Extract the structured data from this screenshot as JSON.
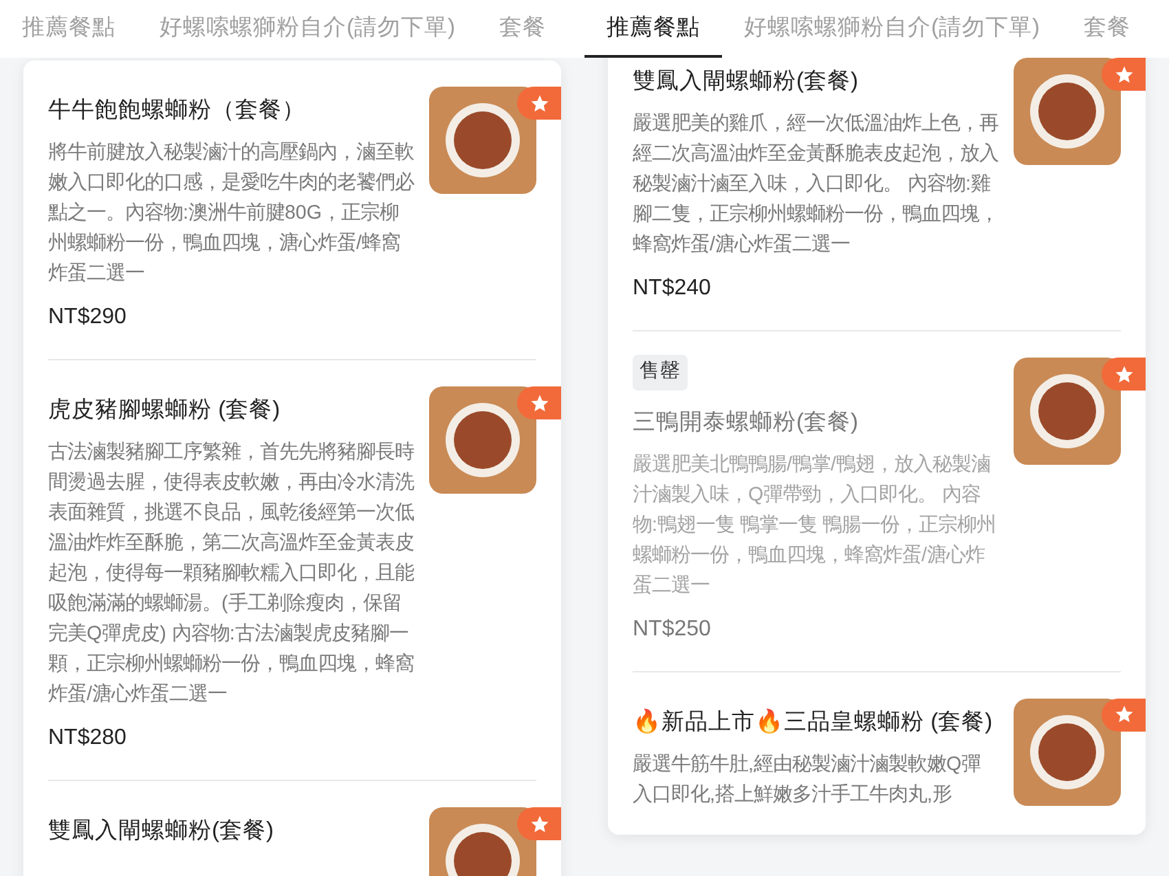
{
  "panels": [
    {
      "tabs": [
        {
          "label": "推薦餐點",
          "selected": false
        },
        {
          "label": "好螺嗦螺獅粉自介(請勿下單)",
          "selected": false
        },
        {
          "label": "套餐",
          "selected": false
        }
      ],
      "scrolled": false,
      "items": [
        {
          "title": "牛牛飽飽螺螄粉（套餐）",
          "description": "將牛前腱放入秘製滷汁的高壓鍋內，滷至軟嫩入口即化的口感，是愛吃牛肉的老饕們必點之一。內容物:澳洲牛前腱80G，正宗柳州螺螄粉一份，鴨血四塊，溏心炸蛋/蜂窩炸蛋二選一",
          "price": "NT$290",
          "starred": true,
          "sold_out": false
        },
        {
          "title": "虎皮豬腳螺螄粉 (套餐)",
          "description": "古法滷製豬腳工序繁雜，首先先將豬腳長時間燙過去腥，使得表皮軟嫩，再由冷水清洗表面雜質，挑選不良品，風乾後經第一次低溫油炸炸至酥脆，第二次高溫炸至金黃表皮起泡，使得每一顆豬腳軟糯入口即化，且能吸飽滿滿的螺螄湯。(手工剃除瘦肉，保留完美Q彈虎皮) 內容物:古法滷製虎皮豬腳一顆，正宗柳州螺螄粉一份，鴨血四塊，蜂窩炸蛋/溏心炸蛋二選一",
          "price": "NT$280",
          "starred": true,
          "sold_out": false
        },
        {
          "title": "雙鳳入閘螺螄粉(套餐)",
          "starred": true,
          "sold_out": false
        }
      ]
    },
    {
      "tabs": [
        {
          "label": "推薦餐點",
          "selected": true
        },
        {
          "label": "好螺嗦螺獅粉自介(請勿下單)",
          "selected": false
        },
        {
          "label": "套餐",
          "selected": false
        }
      ],
      "scrolled": true,
      "items": [
        {
          "title": "雙鳳入閘螺螄粉(套餐)",
          "description": "嚴選肥美的雞爪，經一次低溫油炸上色，再經二次高溫油炸至金黃酥脆表皮起泡，放入秘製滷汁滷至入味，入口即化。 內容物:雞腳二隻，正宗柳州螺螄粉一份，鴨血四塊，蜂窩炸蛋/溏心炸蛋二選一",
          "price": "NT$240",
          "starred": true,
          "sold_out": false
        },
        {
          "badge": "售罄",
          "title": "三鴨開泰螺螄粉(套餐)",
          "description": "嚴選肥美北鴨鴨腸/鴨掌/鴨翅，放入秘製滷汁滷製入味，Q彈帶勁，入口即化。 內容物:鴨翅一隻 鴨掌一隻 鴨腸一份，正宗柳州螺螄粉一份，鴨血四塊，蜂窩炸蛋/溏心炸蛋二選一",
          "price": "NT$250",
          "starred": true,
          "sold_out": true
        },
        {
          "title": "🔥新品上市🔥三品皇螺螄粉 (套餐)",
          "description": "嚴選牛筋牛肚,經由秘製滷汁滷製軟嫩Q彈入口即化,搭上鮮嫩多汁手工牛肉丸,形",
          "starred": true,
          "sold_out": false
        }
      ]
    }
  ]
}
